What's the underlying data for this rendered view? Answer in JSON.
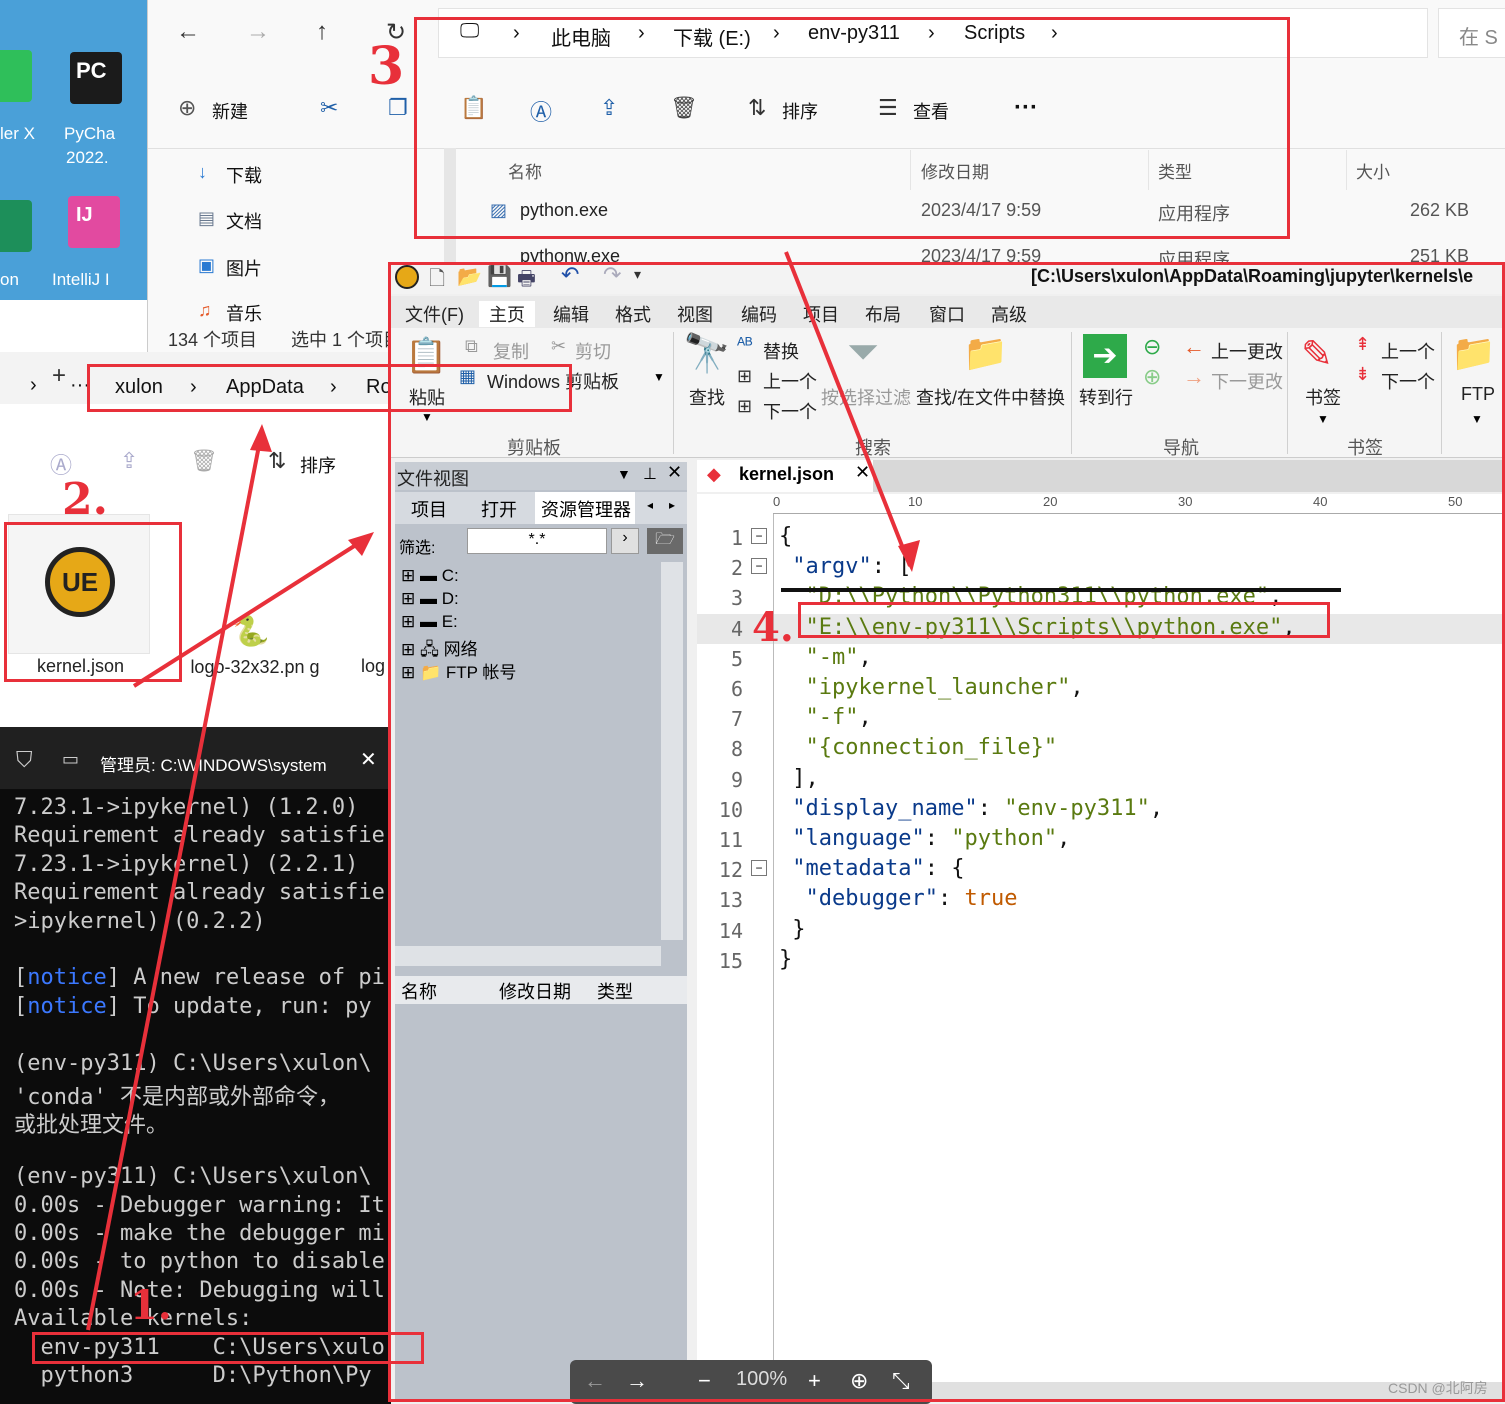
{
  "desktop": {
    "icons": [
      {
        "label": "ler X"
      },
      {
        "label": "PyCha"
      },
      {
        "label": "2022."
      },
      {
        "label": "on"
      },
      {
        "label": "IntelliJ I"
      }
    ]
  },
  "explorer1": {
    "breadcrumb": [
      "此电脑",
      "下载 (E:)",
      "env-py311",
      "Scripts"
    ],
    "search_placeholder": "在 S",
    "toolbar": {
      "new": "新建",
      "sort": "排序",
      "view": "查看",
      "more": "···"
    },
    "nav": [
      "下载",
      "文档",
      "图片",
      "音乐"
    ],
    "columns": {
      "name": "名称",
      "date": "修改日期",
      "type": "类型",
      "size": "大小"
    },
    "files": [
      {
        "name": "python.exe",
        "date": "2023/4/17 9:59",
        "type": "应用程序",
        "size": "262 KB"
      },
      {
        "name": "pythonw.exe",
        "date": "2023/4/17 9:59",
        "type": "应用程序",
        "size": "251 KB"
      }
    ],
    "status": {
      "count": "134 个项目",
      "selected": "选中 1 个项目"
    }
  },
  "explorer2": {
    "breadcrumb": [
      "xulon",
      "AppData",
      "Ro"
    ],
    "sort": "排序",
    "files": [
      {
        "name": "kernel.json"
      },
      {
        "name": "logo-32x32.pn g"
      },
      {
        "name": "log"
      }
    ]
  },
  "terminal": {
    "title": "管理员: C:\\WINDOWS\\system",
    "lines": [
      "7.23.1->ipykernel) (1.2.0)",
      "Requirement already satisfie",
      "7.23.1->ipykernel) (2.2.1)",
      "Requirement already satisfie",
      ">ipykernel) (0.2.2)",
      "",
      "[notice] A new release of pi",
      "[notice] To update, run: py",
      "",
      "(env-py311) C:\\Users\\xulon\\",
      "'conda' 不是内部或外部命令，",
      "或批处理文件。",
      "",
      "(env-py311) C:\\Users\\xulon\\",
      "0.00s - Debugger warning: It",
      "0.00s - make the debugger mi",
      "0.00s - to python to disable",
      "0.00s - Note: Debugging will",
      "Available kernels:",
      "  env-py311    C:\\Users\\xulo",
      "  python3      D:\\Python\\Py"
    ]
  },
  "ue": {
    "title": "[C:\\Users\\xulon\\AppData\\Roaming\\jupyter\\kernels\\e",
    "menu": [
      "文件(F)",
      "主页",
      "编辑",
      "格式",
      "视图",
      "编码",
      "项目",
      "布局",
      "窗口",
      "高级"
    ],
    "ribbon": {
      "paste": "粘贴",
      "copy": "复制",
      "cut": "剪切",
      "windows_clipboard": "Windows 剪贴板",
      "find": "查找",
      "replace": "替换",
      "prev": "上一个",
      "next": "下一个",
      "filter": "按选择过滤",
      "find_in_files": "查找/在文件中替换",
      "goto": "转到行",
      "prev_change": "上一更改",
      "next_change": "下一更改",
      "bookmark": "书签",
      "bm_prev": "上一个",
      "bm_next": "下一个",
      "ftp": "FTP",
      "groups": [
        "剪贴板",
        "搜索",
        "导航",
        "书签"
      ]
    },
    "fileview": {
      "title": "文件视图",
      "tabs": [
        "项目",
        "打开",
        "资源管理器"
      ],
      "filter_label": "筛选:",
      "filter_value": "*.*",
      "tree": [
        "C:",
        "D:",
        "E:",
        "网络",
        "FTP 帐号"
      ],
      "columns": [
        "名称",
        "修改日期",
        "类型"
      ]
    },
    "tab": "kernel.json",
    "ruler": [
      "0",
      "10",
      "20",
      "30",
      "40",
      "50"
    ],
    "code": [
      "{",
      " \"argv\": [",
      "  \"D:\\\\Python\\\\Python311\\\\python.exe\",",
      "  \"E:\\\\env-py311\\\\Scripts\\\\python.exe\",",
      "  \"-m\",",
      "  \"ipykernel_launcher\",",
      "  \"-f\",",
      "  \"{connection_file}\"",
      " ],",
      " \"display_name\": \"env-py311\",",
      " \"language\": \"python\",",
      " \"metadata\": {",
      "  \"debugger\": true",
      " }",
      "}"
    ],
    "zoom": "100%"
  },
  "annotations": {
    "n1": "1.",
    "n2": "2.",
    "n3": "3",
    "n4": "4."
  },
  "watermark": "CSDN @北阿房"
}
